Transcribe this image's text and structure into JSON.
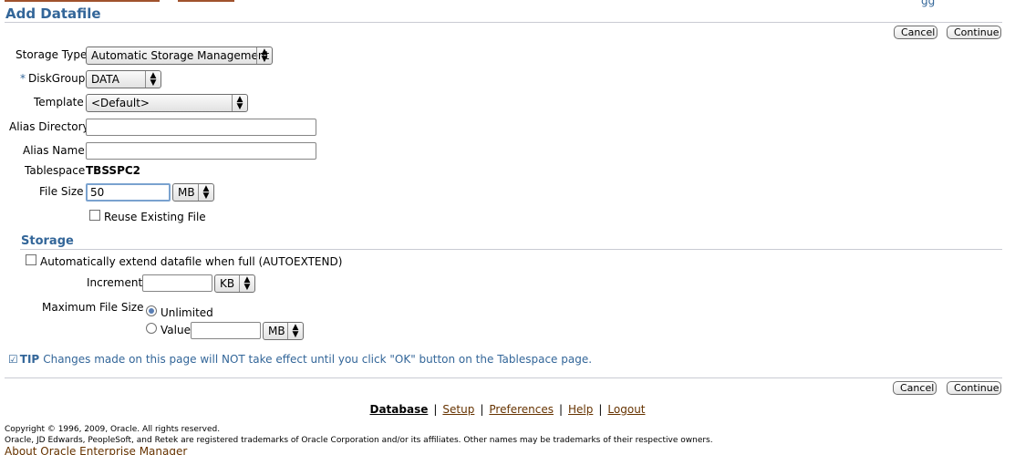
{
  "page": {
    "title": "Add Datafile"
  },
  "header": {
    "corner_glyph": "gg"
  },
  "buttons": {
    "cancel": "Cancel",
    "continue": "Continue"
  },
  "form": {
    "storage_type": {
      "label": "Storage Type",
      "value": "Automatic Storage Management"
    },
    "disk_group": {
      "required_mark": "*",
      "label": "DiskGroup",
      "value": "DATA"
    },
    "template": {
      "label": "Template",
      "value": "<Default>"
    },
    "alias_directory": {
      "label": "Alias Directory",
      "value": ""
    },
    "alias_name": {
      "label": "Alias Name",
      "value": ""
    },
    "tablespace": {
      "label": "Tablespace",
      "value": "TBSSPC2"
    },
    "file_size": {
      "label": "File Size",
      "value": "50",
      "unit": "MB"
    },
    "reuse_existing": {
      "label": "Reuse Existing File",
      "checked": false
    }
  },
  "storage": {
    "section_title": "Storage",
    "autoextend": {
      "label": "Automatically extend datafile when full (AUTOEXTEND)",
      "checked": false
    },
    "increment": {
      "label": "Increment",
      "value": "",
      "unit": "KB"
    },
    "max_file_size": {
      "label": "Maximum File Size",
      "unlimited_label": "Unlimited",
      "value_label": "Value",
      "value": "",
      "unit": "MB",
      "selected": "Unlimited"
    }
  },
  "tip": {
    "icon": "check-icon",
    "label": "TIP",
    "text": "Changes made on this page will NOT take effect until you click \"OK\" button on the Tablespace page."
  },
  "footer": {
    "links": [
      "Database",
      "Setup",
      "Preferences",
      "Help",
      "Logout"
    ],
    "separator": "|",
    "copyright_line1": "Copyright © 1996, 2009, Oracle. All rights reserved.",
    "copyright_line2": "Oracle, JD Edwards, PeopleSoft, and Retek are registered trademarks of Oracle Corporation and/or its affiliates. Other names may be trademarks of their respective owners.",
    "about_link": "About Oracle Enterprise Manager"
  },
  "colors": {
    "brand_blue": "#336699",
    "link_brown": "#663300",
    "top_accent": "#a0522d"
  }
}
